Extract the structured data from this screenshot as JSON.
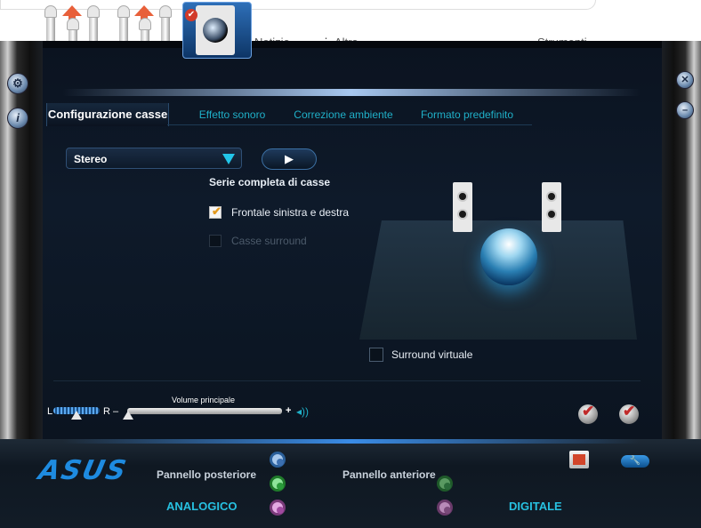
{
  "background": {
    "nav_items": [
      "Notizie",
      "Altro",
      "Strumenti"
    ]
  },
  "device": {
    "selected_icon": "speaker-device-icon"
  },
  "side": {
    "left_buttons": [
      "settings-icon",
      "info-icon"
    ],
    "right_buttons": [
      "close-icon",
      "minimize-icon"
    ]
  },
  "tabs": [
    {
      "label": "Configurazione casse",
      "active": true
    },
    {
      "label": "Effetto sonoro",
      "active": false
    },
    {
      "label": "Correzione ambiente",
      "active": false
    },
    {
      "label": "Formato predefinito",
      "active": false
    }
  ],
  "config": {
    "speaker_mode": "Stereo",
    "play_label": "▶",
    "section_title": "Serie completa di casse",
    "checkbox_front": "Frontale sinistra e destra",
    "checkbox_front_checked": true,
    "checkbox_surround": "Casse surround",
    "checkbox_surround_checked": false,
    "virtual_surround": "Surround virtuale",
    "virtual_surround_checked": false
  },
  "volume": {
    "title": "Volume principale",
    "left_label": "L",
    "right_label": "R",
    "minus": "–",
    "plus": "+",
    "balance": 0.5,
    "level": 0.0
  },
  "bottom": {
    "brand": "ASUS",
    "rear_panel": "Pannello posteriore",
    "front_panel": "Pannello anteriore",
    "analog": "ANALOGICO",
    "digital": "DIGITALE"
  },
  "colors": {
    "accent": "#1fb0c8",
    "brand_blue": "#1e8be0",
    "checkmark_red": "#c02a2a",
    "port_blue": "#5aa0e0",
    "port_green": "#3ec84a",
    "port_pink": "#c060c0"
  }
}
